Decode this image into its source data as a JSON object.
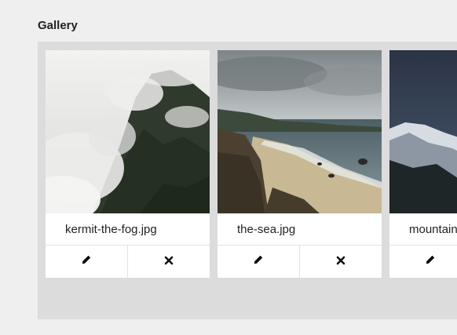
{
  "section": {
    "title": "Gallery"
  },
  "items": [
    {
      "filename": "kermit-the-fog.jpg",
      "image": "foggy-mountain-forest"
    },
    {
      "filename": "the-sea.jpg",
      "image": "rocky-beach-coast"
    },
    {
      "filename": "mountain",
      "image": "snowy-mountain-range"
    }
  ],
  "icons": {
    "edit": "pencil-icon",
    "delete": "close-icon"
  }
}
